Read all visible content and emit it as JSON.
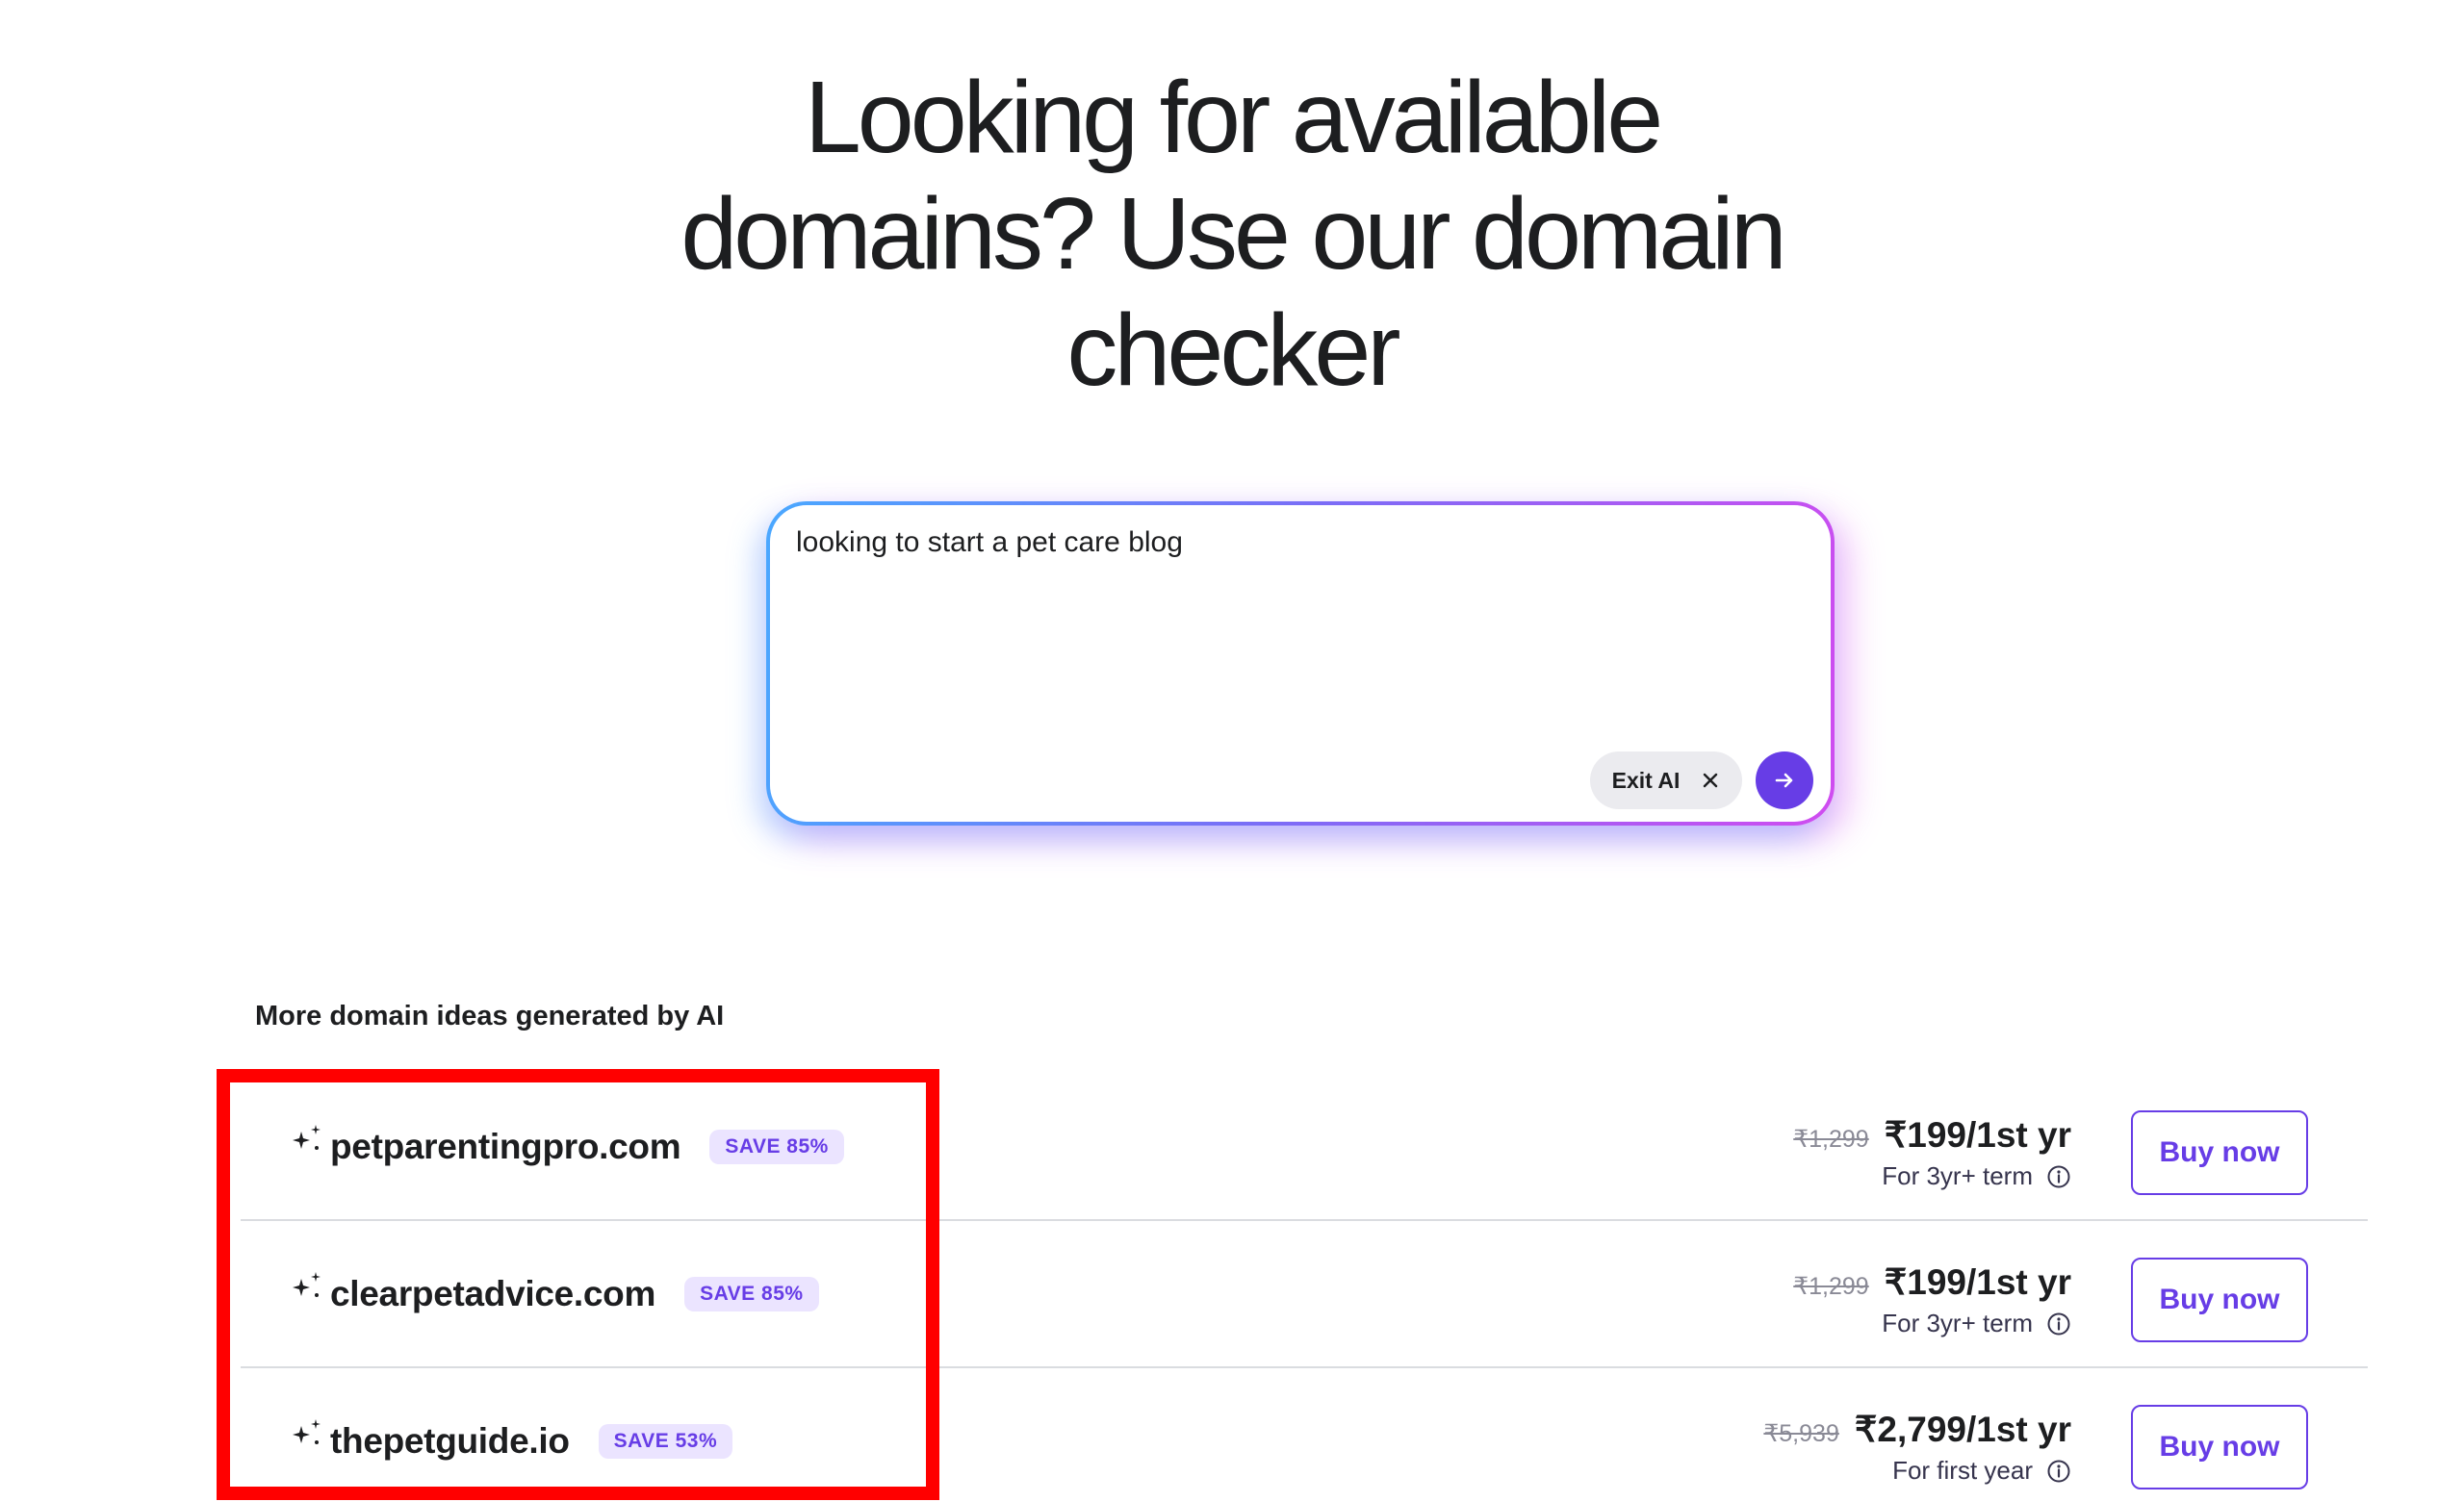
{
  "headline": {
    "line1": "Looking for available",
    "line2": "domains? Use our domain",
    "line3": "checker"
  },
  "prompt": {
    "value": "looking to start a pet care blog",
    "exit_label": "Exit AI"
  },
  "section_title": "More domain ideas generated by AI",
  "results": [
    {
      "domain": "petparentingpro.com",
      "badge": "SAVE 85%",
      "old_price": "₹1,299",
      "price": "₹199/1st yr",
      "term": "For 3yr+ term",
      "button": "Buy now"
    },
    {
      "domain": "clearpetadvice.com",
      "badge": "SAVE 85%",
      "old_price": "₹1,299",
      "price": "₹199/1st yr",
      "term": "For 3yr+ term",
      "button": "Buy now"
    },
    {
      "domain": "thepetguide.io",
      "badge": "SAVE 53%",
      "old_price": "₹5,939",
      "price": "₹2,799/1st yr",
      "term": "For first year",
      "button": "Buy now"
    }
  ],
  "colors": {
    "accent": "#673de6",
    "badge_bg": "#ebe4ff",
    "highlight": "#ff0000"
  }
}
